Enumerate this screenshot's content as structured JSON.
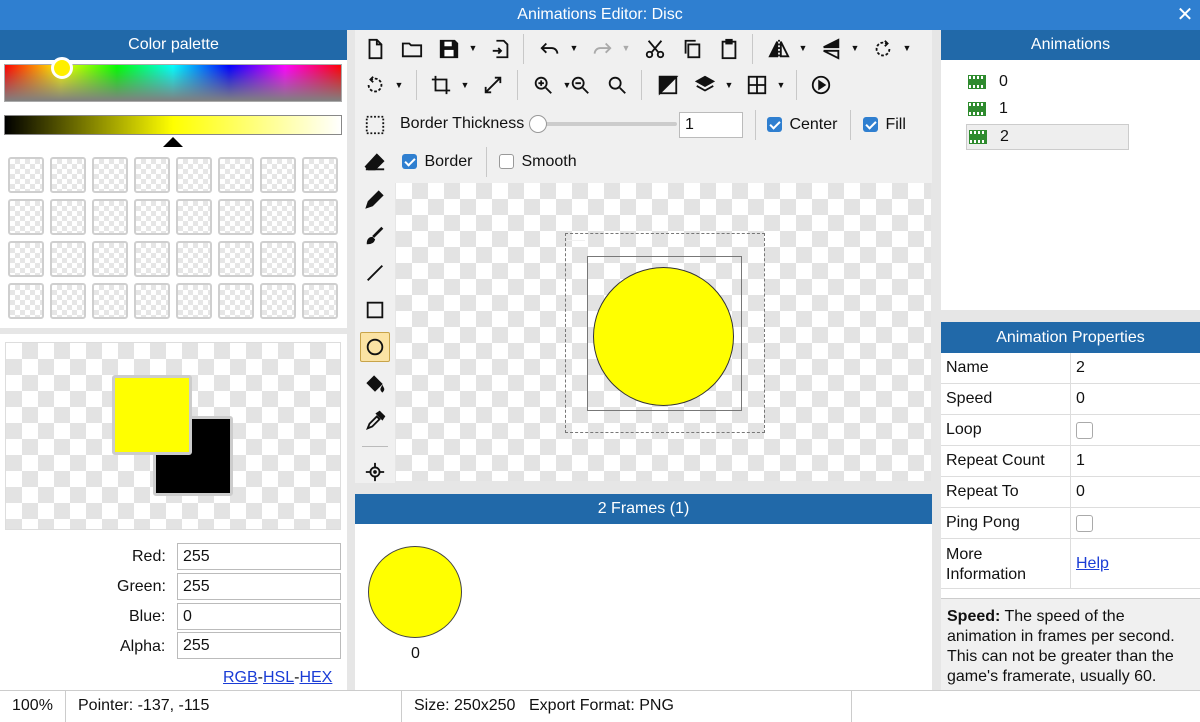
{
  "window": {
    "title": "Animations Editor: Disc"
  },
  "palette": {
    "title": "Color palette",
    "red_label": "Red:",
    "green_label": "Green:",
    "blue_label": "Blue:",
    "alpha_label": "Alpha:",
    "red": "255",
    "green": "255",
    "blue": "0",
    "alpha": "255",
    "links": {
      "rgb": "RGB",
      "sep": "-",
      "hsl": "HSL",
      "hex": "HEX"
    },
    "primary_color": "#ffff00",
    "secondary_color": "#000000"
  },
  "toolbar": {
    "border_thickness_label": "Border Thickness",
    "border_thickness_value": "1",
    "center_label": "Center",
    "fill_label": "Fill",
    "border_label": "Border",
    "smooth_label": "Smooth",
    "slider_level": 0
  },
  "canvas": {
    "shape_color": "#ffff00"
  },
  "frames": {
    "title": "2 Frames (1)",
    "items": [
      {
        "label": "0"
      }
    ]
  },
  "animations": {
    "title": "Animations",
    "items": [
      {
        "label": "0"
      },
      {
        "label": "1"
      },
      {
        "label": "2"
      }
    ]
  },
  "properties": {
    "title": "Animation Properties",
    "name_key": "Name",
    "name_value": "2",
    "speed_key": "Speed",
    "speed_value": "0",
    "loop_key": "Loop",
    "repeat_count_key": "Repeat Count",
    "repeat_count_value": "1",
    "repeat_to_key": "Repeat To",
    "repeat_to_value": "0",
    "ping_pong_key": "Ping Pong",
    "more_info_key_1": "More",
    "more_info_key_2": "Information",
    "help_link": "Help",
    "desc_bold": "Speed:",
    "desc_1": " The speed of the",
    "desc_2": "animation in frames per second.",
    "desc_3": "This can not be greater than the",
    "desc_4": "game's framerate, usually 60."
  },
  "status": {
    "zoom": "100%",
    "pointer": "Pointer: -137, -115",
    "size": "Size: 250x250",
    "export": "Export Format: PNG"
  }
}
